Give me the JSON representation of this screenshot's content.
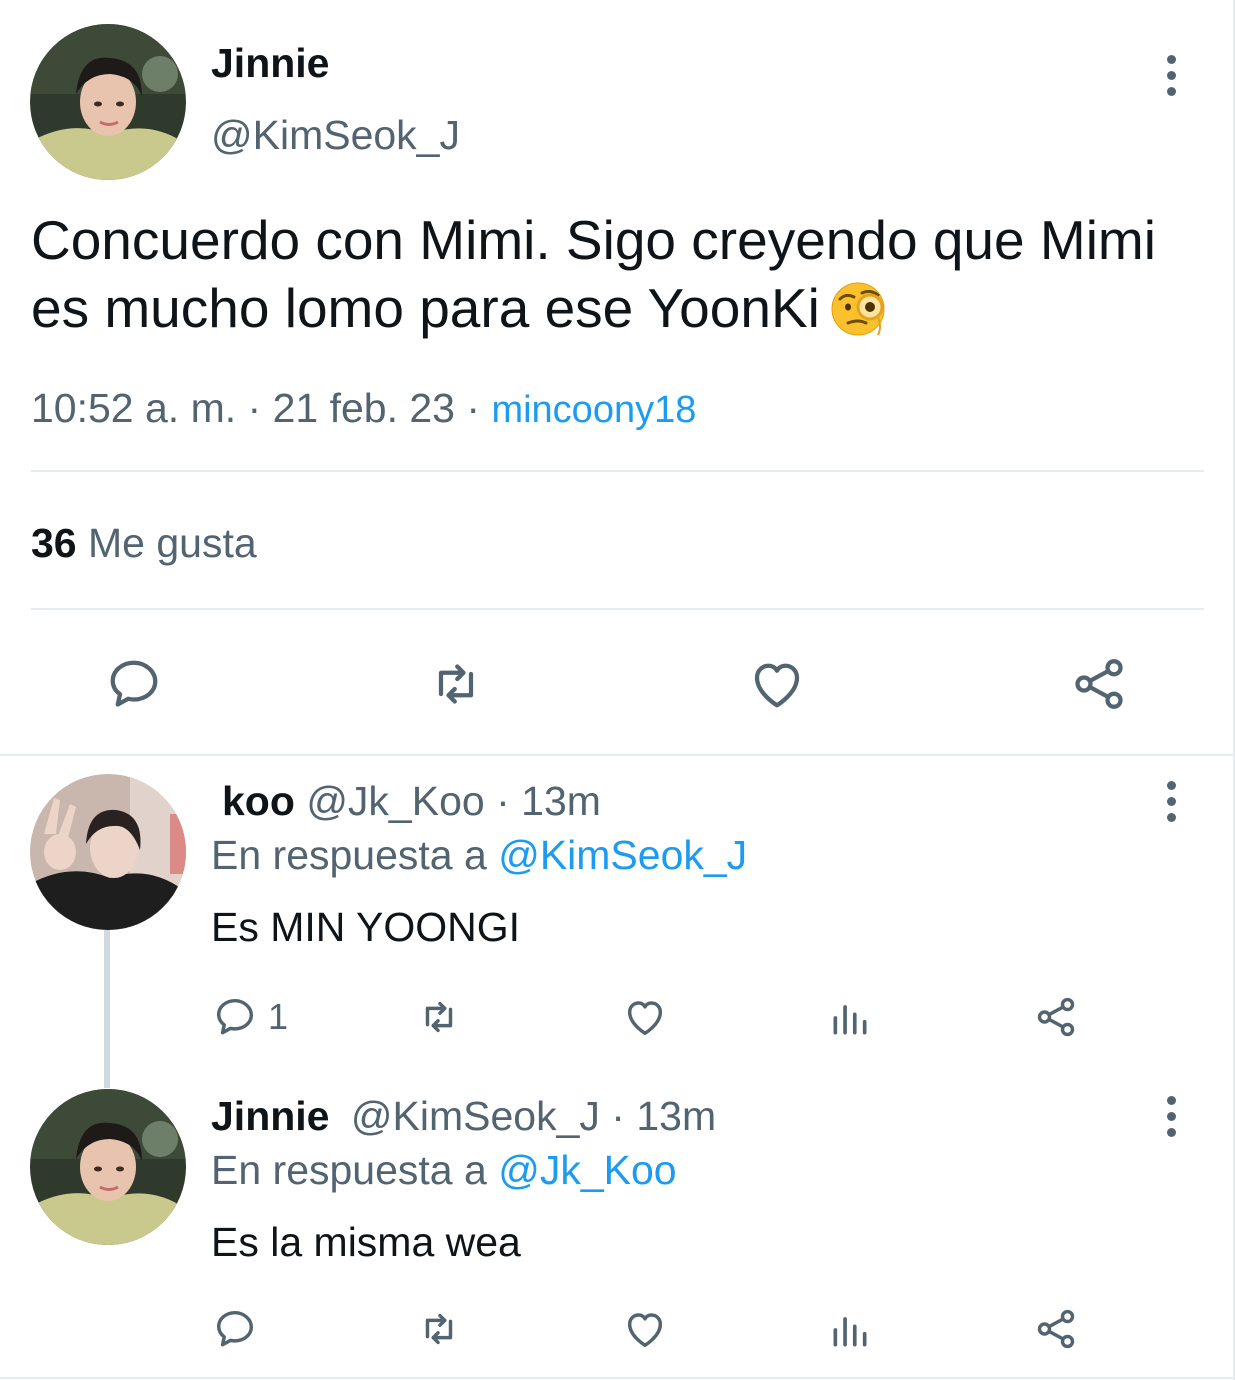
{
  "main_tweet": {
    "display_name": "Jinnie",
    "handle": "@KimSeok_J",
    "text": "Concuerdo con Mimi. Sigo creyendo que Mimi es mucho lomo para ese YoonKi",
    "emoji": "face-with-monocle",
    "time": "10:52 a. m.",
    "separator": "·",
    "date": "21 feb. 23",
    "source": "mincoony18",
    "likes_count": "36",
    "likes_label": "Me gusta",
    "actions": [
      "reply-icon",
      "retweet-icon",
      "like-icon",
      "share-icon"
    ]
  },
  "replies": [
    {
      "display_name": "koo",
      "handle": "@Jk_Koo",
      "separator": "·",
      "time": "13m",
      "reply_prefix": "En respuesta a",
      "reply_mention": "@KimSeok_J",
      "text": "Es MIN YOONGI",
      "reply_count": "1"
    },
    {
      "display_name": "Jinnie",
      "handle": "@KimSeok_J",
      "separator": "·",
      "time": "13m",
      "reply_prefix": "En respuesta a",
      "reply_mention": "@Jk_Koo",
      "text": "Es la misma wea",
      "reply_count": ""
    }
  ],
  "colors": {
    "text": "#0f1419",
    "secondary": "#536471",
    "accent": "#1d9bf0",
    "divider": "#e6ecf0"
  }
}
